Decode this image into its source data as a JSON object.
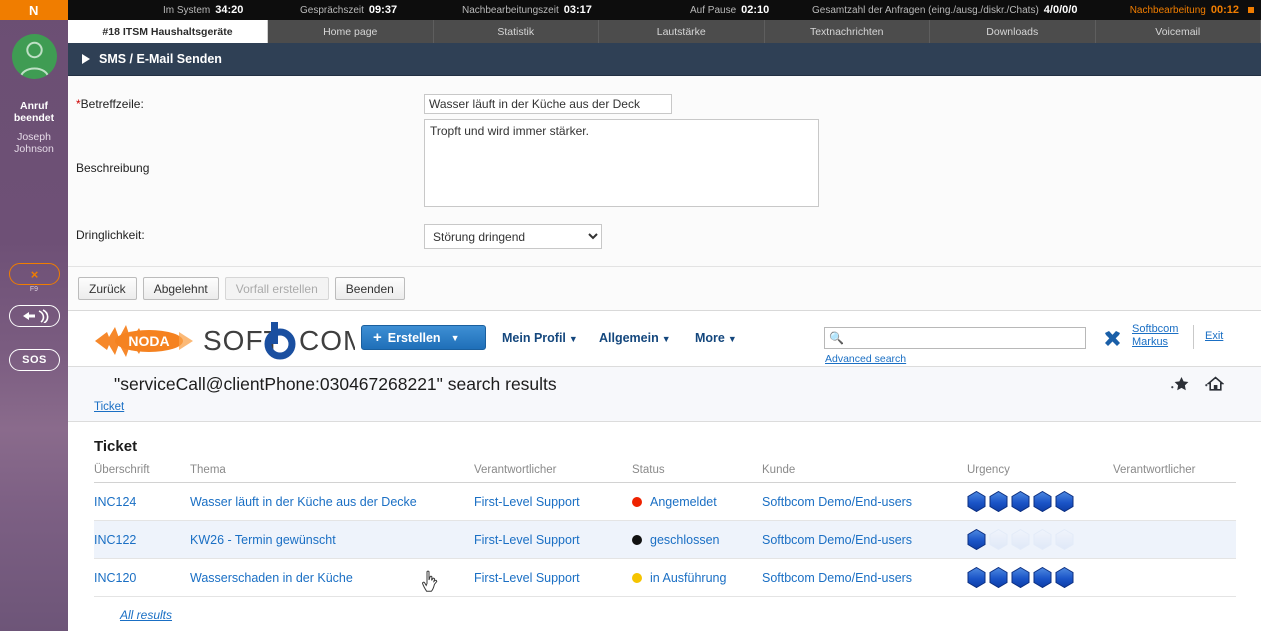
{
  "sidebar": {
    "logo_text": "N",
    "call_state": "Anruf beendet",
    "agent_name": "Joseph Johnson",
    "hangup_label": "×",
    "hangup_hotkey": "F9",
    "sos_label": "SOS",
    "callback_icon": "callback-icon",
    "avatar_icon": "user-avatar-icon"
  },
  "topbar": {
    "stats": [
      {
        "label": "Im System",
        "value": "34:20",
        "alert": false
      },
      {
        "label": "Gesprächszeit",
        "value": "09:37",
        "alert": false
      },
      {
        "label": "Nachbearbeitungszeit",
        "value": "03:17",
        "alert": false
      },
      {
        "label": "Auf Pause",
        "value": "02:10",
        "alert": false
      },
      {
        "label": "Gesamtzahl der Anfragen (eing./ausg./diskr./Chats)",
        "value": "4/0/0/0",
        "alert": false
      },
      {
        "label": "Nachbearbeitung",
        "value": "00:12",
        "alert": true
      }
    ]
  },
  "tabs": [
    {
      "label": "#18 ITSM Haushaltsgeräte",
      "active": true
    },
    {
      "label": "Home page",
      "active": false
    },
    {
      "label": "Statistik",
      "active": false
    },
    {
      "label": "Lautstärke",
      "active": false
    },
    {
      "label": "Textnachrichten",
      "active": false
    },
    {
      "label": "Downloads",
      "active": false
    },
    {
      "label": "Voicemail",
      "active": false
    }
  ],
  "panel": {
    "title": "SMS / E-Mail Senden",
    "fields": {
      "subject_label": "Betreffzeile:",
      "subject_required_mark": "*",
      "subject_value": "Wasser läuft in der Küche aus der Deck",
      "subject_placeholder": "",
      "description_label": "Beschreibung",
      "description_value": "Tropft und wird immer stärker.",
      "description_placeholder": "",
      "urgency_label": "Dringlichkeit:",
      "urgency_value": "Störung dringend",
      "urgency_options": [
        "Störung dringend"
      ]
    },
    "buttons": [
      {
        "label": "Zurück",
        "disabled": false
      },
      {
        "label": "Abgelehnt",
        "disabled": false
      },
      {
        "label": "Vorfall erstellen",
        "disabled": true
      },
      {
        "label": "Beenden",
        "disabled": false
      }
    ]
  },
  "appbar": {
    "brand_noda": "NODA",
    "brand_soft": "SOFT",
    "brand_b": "b",
    "brand_com": "COM",
    "create_label": "Erstellen",
    "nav": [
      {
        "label": "Mein Profil",
        "caret": "▼"
      },
      {
        "label": "Allgemein",
        "caret": "▼"
      },
      {
        "label": "More",
        "caret": "▼"
      }
    ],
    "search_value": "",
    "search_placeholder": "",
    "advanced_search": "Advanced search",
    "user_name": "Softbcom Markus",
    "exit_label": "Exit",
    "wrench_icon": "tools-icon"
  },
  "results": {
    "title": "\"serviceCall@clientPhone:030467268221\" search results",
    "tab_label": "Ticket",
    "favorite_icon": "add-favorite-star-icon",
    "home_icon": "add-home-icon"
  },
  "table": {
    "section_title": "Ticket",
    "columns": [
      "Überschrift",
      "Thema",
      "Verantwortlicher",
      "Status",
      "Kunde",
      "Urgency",
      "Verantwortlicher"
    ],
    "rows": [
      {
        "id": "INC124",
        "subject": "Wasser läuft in der Küche aus der Decke",
        "responsible": "First-Level Support",
        "status": "Angemeldet",
        "status_color": "#ee2200",
        "customer": "Softbcom Demo/End-users",
        "urgency_filled": 5,
        "urgency_total": 5,
        "responsible2": "",
        "highlighted": false
      },
      {
        "id": "INC122",
        "subject": "KW26 - Termin gewünscht",
        "responsible": "First-Level Support",
        "status": "geschlossen",
        "status_color": "#111111",
        "customer": "Softbcom Demo/End-users",
        "urgency_filled": 1,
        "urgency_total": 5,
        "responsible2": "",
        "highlighted": true
      },
      {
        "id": "INC120",
        "subject": "Wasserschaden in der Küche",
        "responsible": "First-Level Support",
        "status": "in Ausführung",
        "status_color": "#f5c400",
        "customer": "Softbcom Demo/End-users",
        "urgency_filled": 5,
        "urgency_total": 5,
        "responsible2": "",
        "highlighted": false
      }
    ],
    "all_results_label": "All results"
  },
  "colors": {
    "accent_orange": "#f07d00",
    "sidebar_purple": "#6e5076",
    "panel_header": "#2f4055",
    "link_blue": "#1a6fc4",
    "brand_blue": "#14477d",
    "avatar_green": "#3f9c53"
  }
}
